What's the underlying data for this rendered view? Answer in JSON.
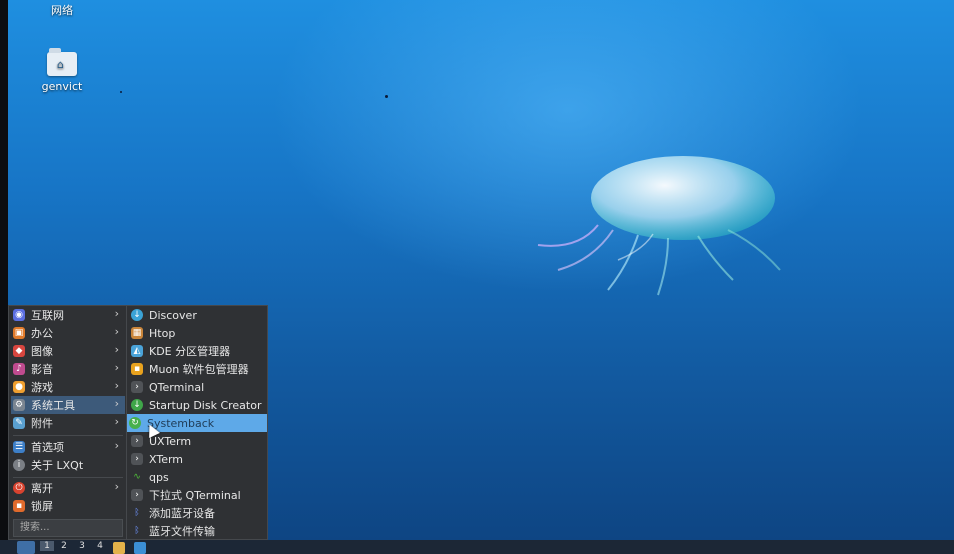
{
  "desktop_icons": [
    {
      "label": "网络",
      "icon": "network-icon"
    },
    {
      "label": "genvict",
      "icon": "home-folder-icon"
    }
  ],
  "menu": {
    "categories": [
      {
        "label": "互联网",
        "icon": "internet-icon",
        "color": "#5b6ee1",
        "has_submenu": true
      },
      {
        "label": "办公",
        "icon": "office-icon",
        "color": "#e07a2a",
        "has_submenu": true
      },
      {
        "label": "图像",
        "icon": "graphics-icon",
        "color": "#d8463f",
        "has_submenu": true
      },
      {
        "label": "影音",
        "icon": "multimedia-icon",
        "color": "#c04b8f",
        "has_submenu": true
      },
      {
        "label": "游戏",
        "icon": "games-icon",
        "color": "#f0a030",
        "has_submenu": true
      },
      {
        "label": "系统工具",
        "icon": "system-tools-icon",
        "color": "#7a8591",
        "has_submenu": true,
        "active": true
      },
      {
        "label": "附件",
        "icon": "accessories-icon",
        "color": "#5aa0d0",
        "has_submenu": true
      }
    ],
    "section2": [
      {
        "label": "首选项",
        "icon": "preferences-icon",
        "color": "#3d7fc8",
        "has_submenu": true
      },
      {
        "label": "关于 LXQt",
        "icon": "info-icon",
        "color": "#7b7f85",
        "has_submenu": false
      }
    ],
    "section3": [
      {
        "label": "离开",
        "icon": "power-icon",
        "color": "#d9432f",
        "has_submenu": true
      },
      {
        "label": "锁屏",
        "icon": "lock-icon",
        "color": "#e06a2c",
        "has_submenu": false
      }
    ],
    "search_placeholder": "搜索...",
    "submenu_items": [
      {
        "label": "Discover",
        "icon": "discover-icon",
        "color": "#3ba3d6"
      },
      {
        "label": "Htop",
        "icon": "htop-icon",
        "color": "#c9853a"
      },
      {
        "label": "KDE 分区管理器",
        "icon": "partition-manager-icon",
        "color": "#4aa3d8"
      },
      {
        "label": "Muon 软件包管理器",
        "icon": "muon-icon",
        "color": "#e8a21e"
      },
      {
        "label": "QTerminal",
        "icon": "terminal-icon",
        "color": "#505357"
      },
      {
        "label": "Startup Disk Creator",
        "icon": "startup-disk-icon",
        "color": "#3fa649"
      },
      {
        "label": "Systemback",
        "icon": "systemback-icon",
        "color": "#48b04c",
        "highlighted": true
      },
      {
        "label": "UXTerm",
        "icon": "uxterm-icon",
        "color": "#505357"
      },
      {
        "label": "XTerm",
        "icon": "xterm-icon",
        "color": "#505357"
      },
      {
        "label": "qps",
        "icon": "qps-icon",
        "color": "#4fbf3a"
      },
      {
        "label": "下拉式 QTerminal",
        "icon": "dropdown-terminal-icon",
        "color": "#505357"
      },
      {
        "label": "添加蓝牙设备",
        "icon": "bluetooth-icon",
        "color": "#4f74d8"
      },
      {
        "label": "蓝牙文件传输",
        "icon": "bluetooth-icon",
        "color": "#4f74d8"
      }
    ]
  },
  "taskbar": {
    "workspaces": [
      "1",
      "2",
      "3",
      "4"
    ],
    "current_workspace": "1"
  }
}
